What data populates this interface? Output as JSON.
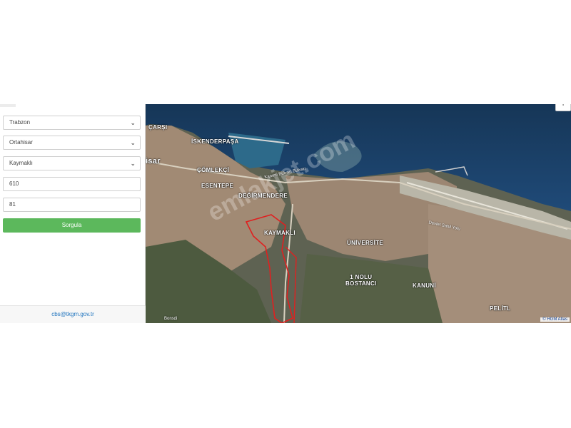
{
  "filters": {
    "province": "Trabzon",
    "district": "Ortahisar",
    "neighborhood": "Kaymaklı",
    "block": "610",
    "parcel": "81",
    "query_label": "Sorgula"
  },
  "footer": {
    "email": "cbs@tkgm.gov.tr"
  },
  "map": {
    "labels": {
      "carsi": "ÇARŞI",
      "hisar": "isar",
      "iskenderpasa": "İSKENDERPAŞA",
      "comlekci": "ÇÖMLEKÇİ",
      "esentepe": "ESENTEPE",
      "degirmendere": "DEĞİRMENDERE",
      "kaymakli": "KAYMAKLI",
      "universite": "ÜNİVERSİTE",
      "bostanci": "1 NOLU\nBOSTANCI",
      "kanuni": "KANUNİ",
      "pelitli": "PELİTL",
      "road1": "Kanuni Bulvarı Bulvarı",
      "road2": "Devlet Sahil Yolu",
      "bottom": "Bonsdi"
    },
    "watermark": "emlakjet.com",
    "attribution": "© HGM Atlas",
    "corner_button": "+",
    "colors": {
      "sea": "#1c3d66",
      "land": "#6b6a56",
      "urban": "#a58d79",
      "parcel_outline": "#e02020",
      "airport": "#b9b6a8"
    }
  }
}
